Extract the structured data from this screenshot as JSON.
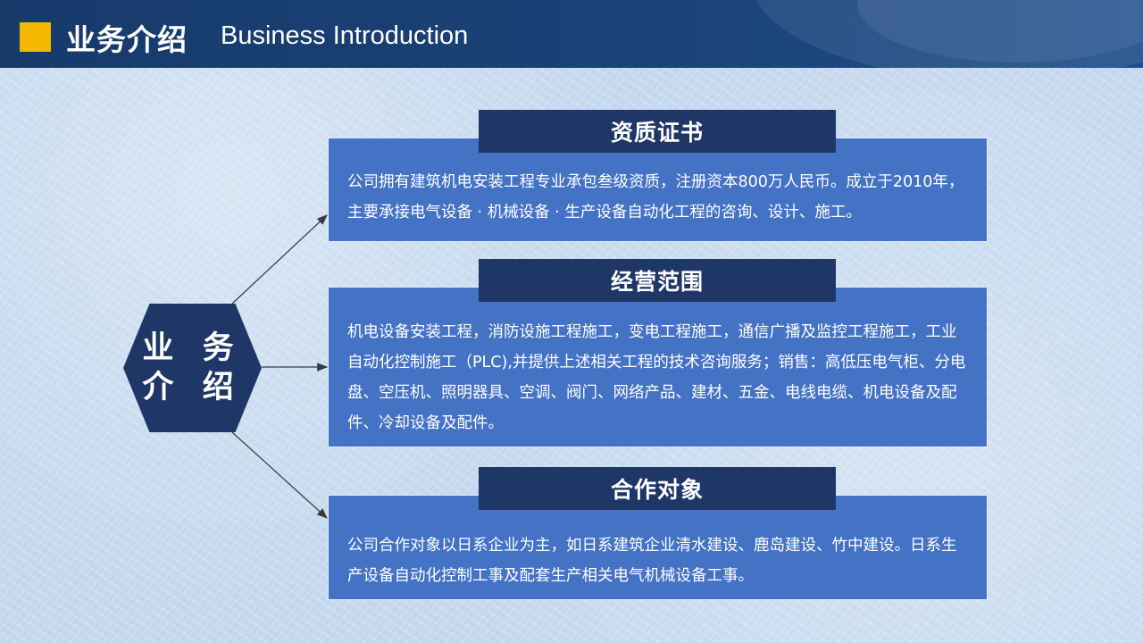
{
  "header": {
    "title_cn": "业务介绍",
    "title_en": "Business Introduction"
  },
  "center": {
    "line1": "业 务",
    "line2": "介 绍"
  },
  "sections": [
    {
      "title": "资质证书",
      "body": "公司拥有建筑机电安装工程专业承包叁级资质，注册资本800万人民币。成立于2010年，主要承接电气设备 · 机械设备 · 生产设备自动化工程的咨询、设计、施工。"
    },
    {
      "title": "经营范围",
      "body": "机电设备安装工程，消防设施工程施工，变电工程施工，通信广播及监控工程施工，工业自动化控制施工（PLC),并提供上述相关工程的技术咨询服务；销售：高低压电气柜、分电盘、空压机、照明器具、空调、阀门、网络产品、建材、五金、电线电缆、机电设备及配件、冷却设备及配件。"
    },
    {
      "title": "合作对象",
      "body": "公司合作对象以日系企业为主，如日系建筑企业清水建设、鹿岛建设、竹中建设。日系生产设备自动化控制工事及配套生产相关电气机械设备工事。"
    }
  ],
  "colors": {
    "navy": "#1f3766",
    "box_blue": "#4472c4",
    "accent_yellow": "#f5b800",
    "header": "#1b4378"
  }
}
